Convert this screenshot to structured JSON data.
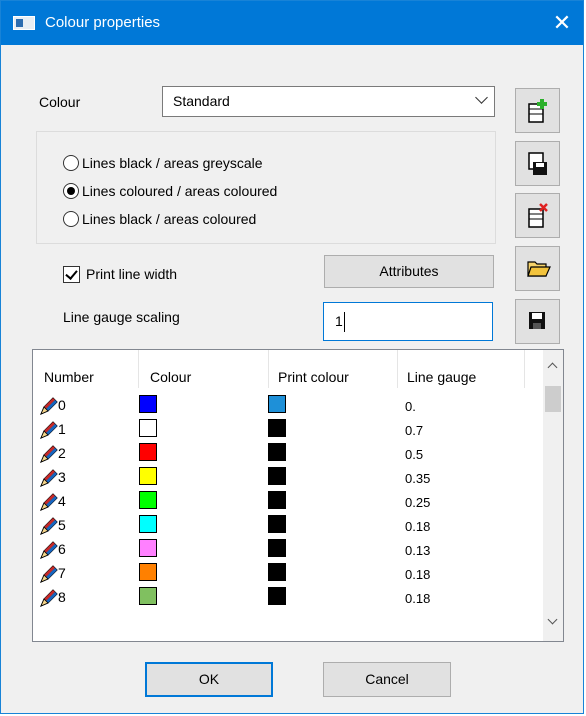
{
  "window": {
    "title": "Colour properties",
    "close_glyph": "✕"
  },
  "colour": {
    "label": "Colour",
    "selected": "Standard"
  },
  "radios": [
    {
      "label": "Lines black / areas greyscale",
      "checked": false
    },
    {
      "label": "Lines coloured / areas coloured",
      "checked": true
    },
    {
      "label": "Lines black / areas coloured",
      "checked": false
    }
  ],
  "print_line_width": {
    "label": "Print line width",
    "checked": true
  },
  "attributes_button": "Attributes",
  "scaling": {
    "label": "Line gauge scaling",
    "value": "1"
  },
  "side_buttons": [
    "new-icon",
    "save-as-icon",
    "delete-icon",
    "open-folder-icon",
    "save-icon"
  ],
  "table": {
    "columns": [
      "Number",
      "Colour",
      "Print colour",
      "Line gauge"
    ],
    "rows": [
      {
        "number": "0",
        "colour": "#0000ff",
        "print_colour": "#1e90d8",
        "line_gauge": "0."
      },
      {
        "number": "1",
        "colour": "#ffffff",
        "print_colour": "#000000",
        "line_gauge": "0.7"
      },
      {
        "number": "2",
        "colour": "#ff0000",
        "print_colour": "#000000",
        "line_gauge": "0.5"
      },
      {
        "number": "3",
        "colour": "#ffff00",
        "print_colour": "#000000",
        "line_gauge": "0.35"
      },
      {
        "number": "4",
        "colour": "#00ff00",
        "print_colour": "#000000",
        "line_gauge": "0.25"
      },
      {
        "number": "5",
        "colour": "#00ffff",
        "print_colour": "#000000",
        "line_gauge": "0.18"
      },
      {
        "number": "6",
        "colour": "#ff80ff",
        "print_colour": "#000000",
        "line_gauge": "0.13"
      },
      {
        "number": "7",
        "colour": "#ff8000",
        "print_colour": "#000000",
        "line_gauge": "0.18"
      },
      {
        "number": "8",
        "colour": "#80c060",
        "print_colour": "#000000",
        "line_gauge": "0.18"
      }
    ]
  },
  "buttons": {
    "ok": "OK",
    "cancel": "Cancel"
  }
}
